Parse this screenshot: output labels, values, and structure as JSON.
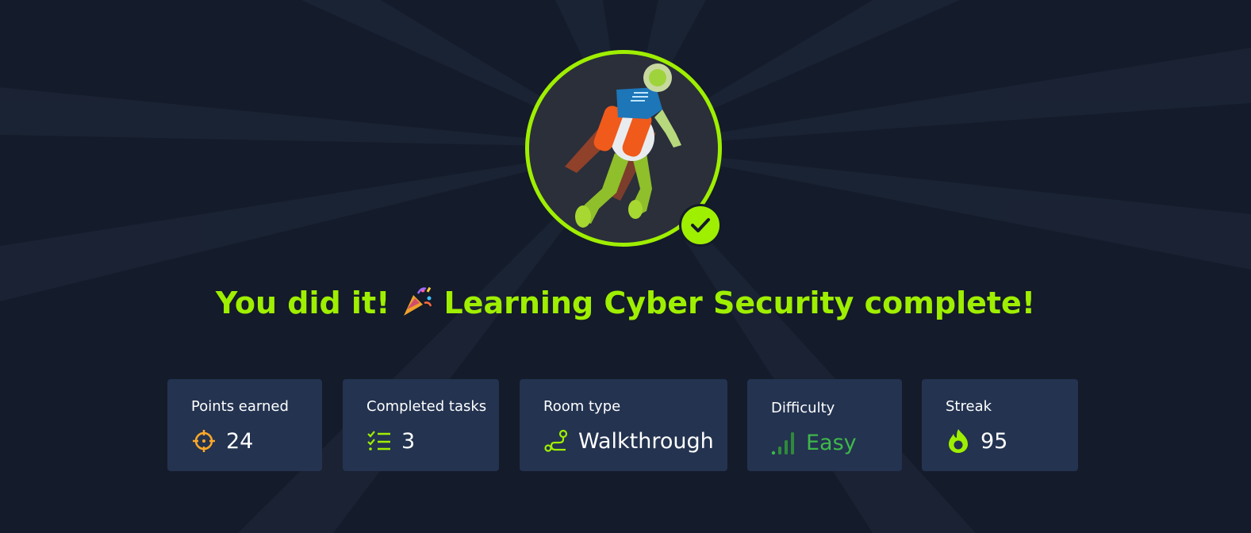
{
  "headline": {
    "prefix": "You did it!",
    "emoji": "🎉",
    "suffix": "Learning Cyber Security complete!"
  },
  "avatar": {
    "icon": "astronaut-jetpack-illustration",
    "badge_icon": "checkmark-icon"
  },
  "stats": [
    {
      "label": "Points earned",
      "value": "24",
      "icon": "target-icon"
    },
    {
      "label": "Completed tasks",
      "value": "3",
      "icon": "checklist-icon"
    },
    {
      "label": "Room type",
      "value": "Walkthrough",
      "icon": "route-icon"
    },
    {
      "label": "Difficulty",
      "value": "Easy",
      "icon": "signal-bars-icon"
    },
    {
      "label": "Streak",
      "value": "95",
      "icon": "flame-icon"
    }
  ],
  "colors": {
    "background": "#141b2a",
    "accent": "#9fef00",
    "card": "#233350",
    "easy": "#3fb74a",
    "points_icon": "#ffa827"
  }
}
